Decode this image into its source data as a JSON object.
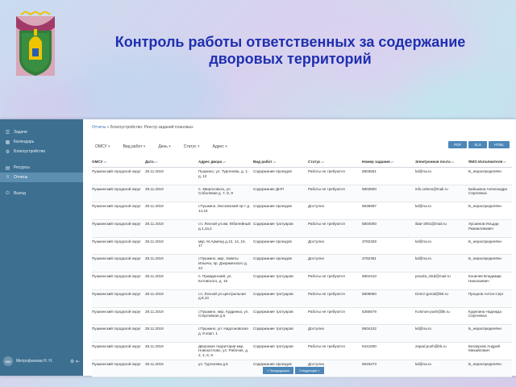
{
  "title": "Контроль работы ответственных за содержание дворовых территорий",
  "sidebar": {
    "items": [
      {
        "label": "Задачи",
        "icon": "tasks-icon"
      },
      {
        "label": "Календарь",
        "icon": "calendar-icon"
      },
      {
        "label": "Благоустройство",
        "icon": "settings-icon"
      },
      {
        "label": "Ресурсы",
        "icon": "folder-icon"
      },
      {
        "label": "Отчеты",
        "icon": "report-icon"
      },
      {
        "label": "Выход",
        "icon": "exit-icon"
      }
    ],
    "user": {
      "initials": "ММ",
      "name": "Митрофанова Н. Н."
    }
  },
  "breadcrumb": {
    "link": "Отчеты",
    "rest": "» Благоустройство: Реестр заданий плановых"
  },
  "filters": [
    "ОМСУ",
    "Вид работ",
    "День",
    "Статус",
    "Адрес"
  ],
  "buttons": [
    "PDF",
    "XLS",
    "HTML"
  ],
  "table": {
    "headers": [
      "ОМСУ",
      "Дата",
      "Адрес двора",
      "Вид работ",
      "Статус",
      "Номер задания",
      "Электронная почта",
      "ФИО Исполнителя"
    ],
    "rows": [
      [
        "Пушкинский городской округ",
        "28.11.2019",
        "Пушкино, ул. Тургенева, д. 1-д, 12",
        "Содержание проездов",
        "Работы не требуются",
        "5803551",
        "kd@na.ru",
        "Б_нераспределённ"
      ],
      [
        "Пушкинский городской округ",
        "28.11.2019",
        "п. Зверосовхоз, ул. Соболевая д. 7, 8, 9",
        "Содержание ДНП",
        "Работы не требуются",
        "5803600",
        "info.celeno@mail.ru",
        "Бабыкина Александра Сергеевна"
      ],
      [
        "Пушкинский городской округ",
        "28.11.2019",
        "г.Пушкино, Московский пр-т д. 14,16",
        "Содержание проездов",
        "Доступно",
        "5839997",
        "kd@na.ru",
        "Б_нераспределённ"
      ],
      [
        "Пушкинский городской округ",
        "28.11.2019",
        "г.п. Лесной ул.им. Юбилейный д.1,1а,2",
        "Содержание тротуаров",
        "Работы не требуются",
        "5804000",
        "ildar-2001@mail.ru",
        "Хусаинов Ильдар Рамзиловович"
      ],
      [
        "Пушкинский городской округ",
        "28.11.2019",
        "мкр. М.Армянд д.13, 14, 16, 17",
        "Содержание проездов",
        "Доступно",
        "3782328",
        "kd@na.ru",
        "Б_нераспределённ"
      ],
      [
        "Пушкинский городской округ",
        "28.11.2019",
        "г.Пушкино, мкр. Заветы Ильича, пр. Дзержинского д. 24",
        "Содержание проездов",
        "Доступно",
        "3782361",
        "kd@na.ru",
        "Б_нераспределённ"
      ],
      [
        "Пушкинский городской округ",
        "28.11.2019",
        "п. Правдинский, ул. Котовского, д. 15",
        "Содержание тротуаров",
        "Работы не требуются",
        "5804410",
        "pravda_mkd@mail.ru",
        "Коничев Владимир Николаевич"
      ],
      [
        "Пушкинский городской округ",
        "28.11.2019",
        "г.п. Лесной ул.Центральная д.8,10",
        "Содержание тротуаров",
        "Работы не требуются",
        "5809650",
        "Dzerz-gorod@list.ru",
        "Процков Антон Серг"
      ],
      [
        "Пушкинский городской округ",
        "28.11.2019",
        "г.Пушкино, мкр. Кудринка, ул. Спортивная д.5",
        "Содержание тротуаров",
        "Работы не требуются",
        "5365679",
        "Kosmos-push@bk.ru",
        "Куделина Надежда Сергеевна"
      ],
      [
        "Пушкинский городской округ",
        "28.11.2019",
        "г.Пушкино, ул. Надсоновская д. 8 корп. 1",
        "Содержание тротуаров",
        "Доступно",
        "5804102",
        "kd@na.ru",
        "Б_нераспределённ"
      ],
      [
        "Пушкинский городской округ",
        "28.11.2019",
        "Дворовая территория мкр. Новокотлово, ул. Рабочая, д. 2, 4, 6, 8",
        "Содержание тротуаров",
        "Работы не требуются",
        "5441830",
        "zapad.push@bk.ru",
        "Беззерхов Андрей Михайлович"
      ],
      [
        "Пушкинский городской округ",
        "28.11.2019",
        "ул. Тургенева д.5",
        "Содержание проездов",
        "Доступно",
        "5819273",
        "kd@na.ru",
        "Б_нераспределённ"
      ]
    ]
  },
  "pager": [
    "« Предыдущая",
    "Следующая »"
  ]
}
